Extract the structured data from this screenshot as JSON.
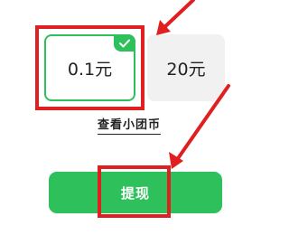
{
  "amounts": [
    {
      "label": "0.1元",
      "selected": true
    },
    {
      "label": "20元",
      "selected": false
    }
  ],
  "link": {
    "view_coins": "查看小团币"
  },
  "button": {
    "withdraw": "提现"
  },
  "colors": {
    "primary_green": "#2ec05a",
    "annotation_red": "#e02020",
    "unselected_bg": "#f1f1f1"
  },
  "icons": {
    "selected_badge": "check-icon"
  }
}
